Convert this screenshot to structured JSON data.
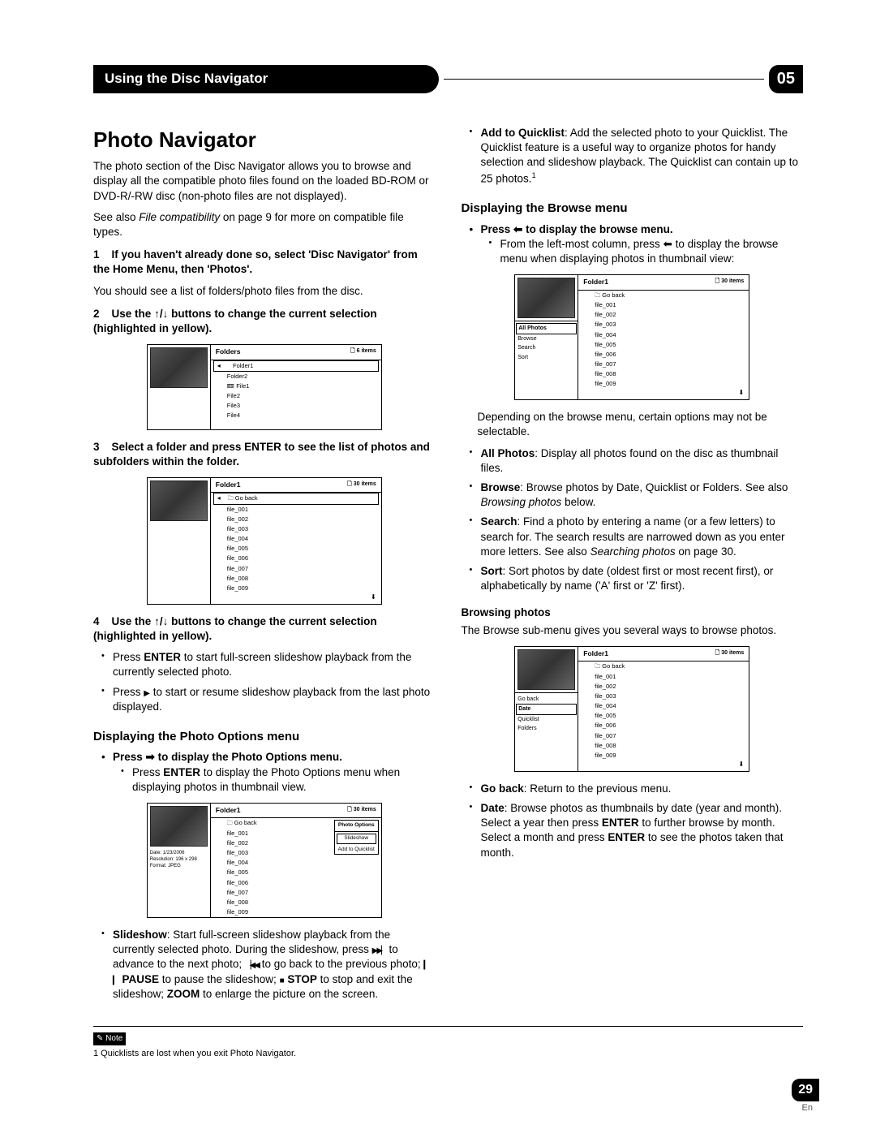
{
  "header": {
    "section_title": "Using the Disc Navigator",
    "chapter": "05"
  },
  "left": {
    "h1": "Photo Navigator",
    "intro": "The photo section of the Disc Navigator allows you to browse and display all the compatible photo files found on the loaded BD-ROM or DVD-R/-RW disc (non-photo files are not displayed).",
    "see_also_pre": "See also ",
    "see_also_italic": "File compatibility",
    "see_also_post": " on page 9 for more on compatible file types.",
    "step1_num": "1",
    "step1_title": "If you haven't already done so, select 'Disc Navigator' from the Home Menu, then 'Photos'.",
    "step1_after": "You should see a list of folders/photo files from the disc.",
    "step2_num": "2",
    "step2_pre": "Use the ",
    "step2_post": " buttons to change the current selection (highlighted in yellow).",
    "mock_folders": {
      "title": "Folders",
      "count": "6 items",
      "rows": [
        "Folder1",
        "Folder2",
        "File1",
        "File2",
        "File3",
        "File4"
      ]
    },
    "step3_num": "3",
    "step3_title": "Select a folder and press ENTER to see the list of photos and subfolders within the folder.",
    "mock_folder1": {
      "title": "Folder1",
      "count": "30 items",
      "rows": [
        "Go back",
        "file_001",
        "file_002",
        "file_003",
        "file_004",
        "file_005",
        "file_006",
        "file_007",
        "file_008",
        "file_009"
      ]
    },
    "step4_num": "4",
    "step4_pre": "Use the ",
    "step4_post": " buttons to change the current selection (highlighted in yellow).",
    "step4_b1_pre": "Press ",
    "step4_b1_bold": "ENTER",
    "step4_b1_post": " to start full-screen slideshow playback from the currently selected photo.",
    "step4_b2_pre": "Press ",
    "step4_b2_post": " to start or resume slideshow playback from the last photo displayed.",
    "opts_h2": "Displaying the Photo Options menu",
    "opts_b1_pre": "Press ",
    "opts_b1_post": " to display the Photo Options menu.",
    "opts_sub_pre": "Press ",
    "opts_sub_bold": "ENTER",
    "opts_sub_post": " to display the Photo Options menu when displaying photos in thumbnail view.",
    "mock_options": {
      "title": "Folder1",
      "count": "30 items",
      "meta1": "Date: 1/23/2006",
      "meta2": "Resolution: 196 x 298",
      "meta3": "Format: JPEG",
      "panel_head": "Photo Options",
      "panel_i1": "Slideshow",
      "panel_i2": "Add to Quicklist",
      "rows": [
        "Go back",
        "file_001",
        "file_002",
        "file_003",
        "file_004",
        "file_005",
        "file_006",
        "file_007",
        "file_008",
        "file_009"
      ]
    },
    "slideshow_bold": "Slideshow",
    "slideshow_text1": ": Start full-screen slideshow playback from the currently selected photo. During the slideshow, press ",
    "slideshow_text2": " to advance to the next photo; ",
    "slideshow_text3": " to go back to the previous photo; ",
    "slideshow_pause": " PAUSE",
    "slideshow_text4": " to pause the slideshow; ",
    "slideshow_stop": " STOP",
    "slideshow_text5": " to stop and exit the slideshow; ",
    "slideshow_zoom": "ZOOM",
    "slideshow_text6": " to enlarge the picture on the screen."
  },
  "right": {
    "quicklist_bold": "Add to Quicklist",
    "quicklist_text": ": Add the selected photo to your Quicklist. The Quicklist feature is a useful way to organize photos for handy selection and slideshow playback. The Quicklist can contain up to 25 photos.",
    "quicklist_sup": "1",
    "browse_h2": "Displaying the Browse menu",
    "browse_b1_pre": "Press ",
    "browse_b1_post": " to display the browse menu.",
    "browse_sub_pre": "From the left-most column, press ",
    "browse_sub_post": " to display the browse menu when displaying photos in thumbnail view:",
    "mock_browse": {
      "title": "Folder1",
      "count": "30 items",
      "menu": [
        "All Photos",
        "Browse",
        "Search",
        "Sort"
      ],
      "rows": [
        "Go back",
        "file_001",
        "file_002",
        "file_003",
        "file_004",
        "file_005",
        "file_006",
        "file_007",
        "file_008",
        "file_009"
      ]
    },
    "browse_depends": "Depending on the browse menu, certain options may not be selectable.",
    "opt_all_b": "All Photos",
    "opt_all_t": ": Display all photos found on the disc as thumbnail files.",
    "opt_browse_b": "Browse",
    "opt_browse_t1": ": Browse photos by Date, Quicklist or Folders. See also ",
    "opt_browse_it": "Browsing photos",
    "opt_browse_t2": " below.",
    "opt_search_b": "Search",
    "opt_search_t1": ": Find a photo by entering a name (or a few letters) to search for. The search results are narrowed down as you enter more letters. See also ",
    "opt_search_it": "Searching photos",
    "opt_search_t2": " on page 30.",
    "opt_sort_b": "Sort",
    "opt_sort_t": ": Sort photos by date (oldest first or most recent first), or alphabetically by name ('A' first or 'Z' first).",
    "browsing_h3": "Browsing photos",
    "browsing_intro": "The Browse sub-menu gives you several ways to browse photos.",
    "mock_browsing": {
      "title": "Folder1",
      "count": "30 items",
      "menu": [
        "Go back",
        "Date",
        "Quicklist",
        "Folders"
      ],
      "rows": [
        "Go back",
        "file_001",
        "file_002",
        "file_003",
        "file_004",
        "file_005",
        "file_006",
        "file_007",
        "file_008",
        "file_009"
      ]
    },
    "br_goback_b": "Go back",
    "br_goback_t": ": Return to the previous menu.",
    "br_date_b": "Date",
    "br_date_t1": ": Browse photos as thumbnails by date (year and month). Select a year then press ",
    "br_date_enter1": "ENTER",
    "br_date_t2": " to further browse by month. Select a month and press ",
    "br_date_enter2": "ENTER",
    "br_date_t3": " to see the photos taken that month."
  },
  "footer": {
    "note_label": "Note",
    "footnote": "1 Quicklists are lost when you exit Photo Navigator.",
    "page_num": "29",
    "lang": "En"
  }
}
